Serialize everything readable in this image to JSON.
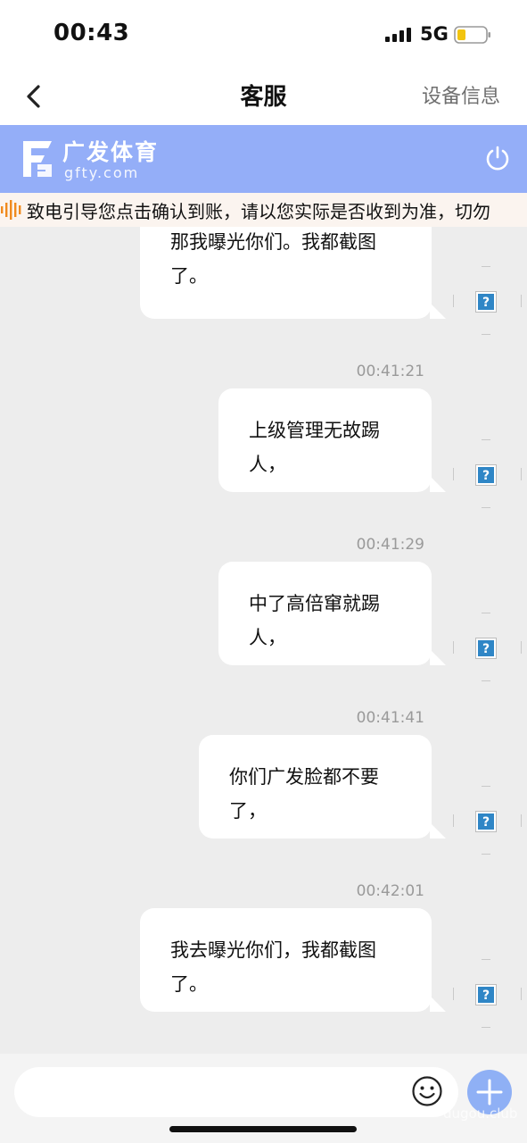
{
  "status_bar": {
    "time": "00:43",
    "network": "5G"
  },
  "nav": {
    "title": "客服",
    "right_label": "设备信息"
  },
  "brand": {
    "name_cn": "广发体育",
    "name_en": "gfty.com",
    "accent": "#94aef8"
  },
  "marquee": {
    "text": "致电引导您点击确认到账，请以您实际是否收到为准，切勿"
  },
  "messages": [
    {
      "time": "",
      "text": "那我曝光你们。我都截图了。",
      "status_icon": "question-icon"
    },
    {
      "time": "00:41:21",
      "text": "上级管理无故踢人，",
      "status_icon": "question-icon"
    },
    {
      "time": "00:41:29",
      "text": "中了高倍窜就踢人，",
      "status_icon": "question-icon"
    },
    {
      "time": "00:41:41",
      "text": "你们广发脸都不要了，",
      "status_icon": "question-icon"
    },
    {
      "time": "00:42:01",
      "text": "我去曝光你们，我都截图了。",
      "status_icon": "question-icon"
    }
  ],
  "input": {
    "placeholder": ""
  },
  "watermark": "dugou.club"
}
